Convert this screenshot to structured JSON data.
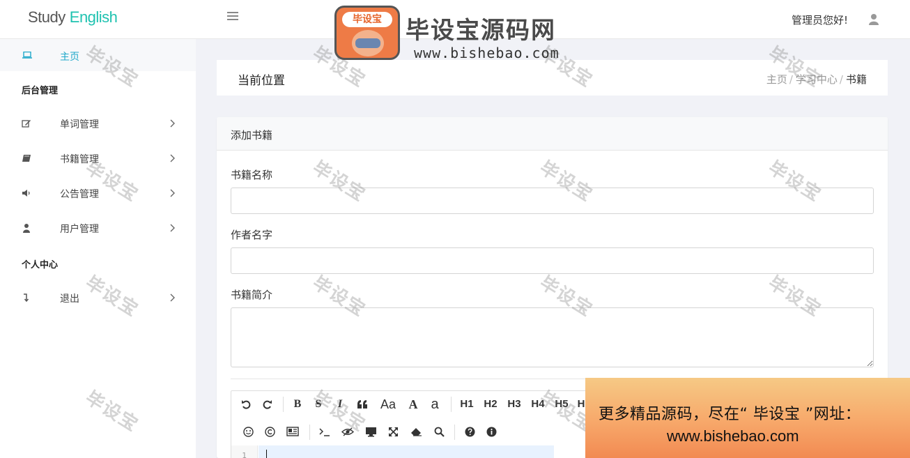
{
  "header": {
    "brand_part1": "Study",
    "brand_part2": "English",
    "greeting": "管理员您好!"
  },
  "sidebar": {
    "home_label": "主页",
    "section_admin": "后台管理",
    "items": [
      {
        "label": "单词管理",
        "icon": "edit-icon"
      },
      {
        "label": "书籍管理",
        "icon": "book-icon"
      },
      {
        "label": "公告管理",
        "icon": "volume-icon"
      },
      {
        "label": "用户管理",
        "icon": "user-icon"
      }
    ],
    "section_personal": "个人中心",
    "logout_label": "退出"
  },
  "breadcrumb_bar": {
    "title": "当前位置",
    "crumbs": [
      "主页",
      "学习中心",
      "书籍"
    ],
    "separator": "/"
  },
  "form": {
    "card_title": "添加书籍",
    "fields": [
      {
        "label": "书籍名称",
        "value": ""
      },
      {
        "label": "作者名字",
        "value": ""
      },
      {
        "label": "书籍简介",
        "value": ""
      }
    ]
  },
  "editor": {
    "toolbar_row1": [
      "B",
      "S",
      "I",
      "Aa",
      "A",
      "a",
      "H1",
      "H2",
      "H3",
      "H4",
      "H5",
      "H"
    ],
    "line_number": "1"
  },
  "watermarks": {
    "text": "毕设宝",
    "logo_tag": "毕设宝",
    "logo_title": "毕设宝源码网",
    "logo_url": "www.bishebao.com",
    "promo_line1": "更多精品源码，尽在“ 毕设宝 ”网址：",
    "promo_line2": "www.bishebao.com"
  },
  "colors": {
    "accent": "#1fa8c9",
    "brand_teal": "#1fc2b0",
    "background": "#f1f2f7"
  }
}
